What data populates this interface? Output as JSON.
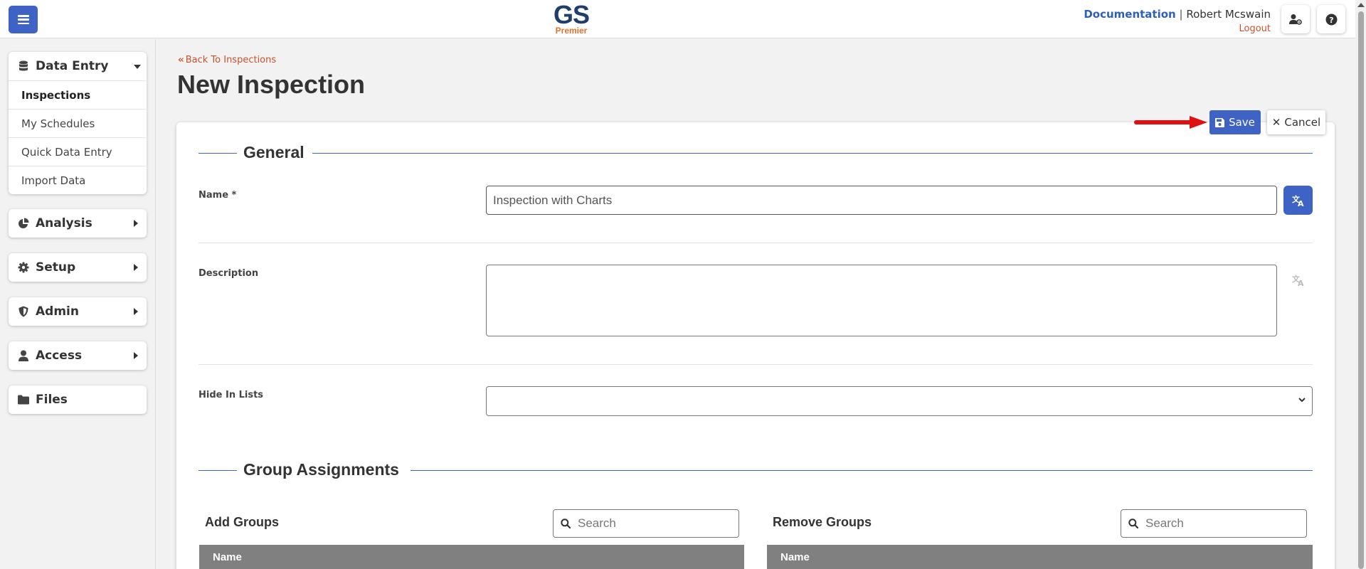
{
  "header": {
    "logo_main": "GS",
    "logo_sub": "Premier",
    "documentation_label": "Documentation",
    "separator": "|",
    "user_name": "Robert Mcswain",
    "logout_label": "Logout"
  },
  "sidebar": {
    "data_entry": {
      "label": "Data Entry",
      "items": [
        {
          "label": "Inspections"
        },
        {
          "label": "My Schedules"
        },
        {
          "label": "Quick Data Entry"
        },
        {
          "label": "Import Data"
        }
      ]
    },
    "analysis_label": "Analysis",
    "setup_label": "Setup",
    "admin_label": "Admin",
    "access_label": "Access",
    "files_label": "Files"
  },
  "main": {
    "back_link": "Back To Inspections",
    "page_title": "New Inspection",
    "save_label": "Save",
    "cancel_label": "Cancel",
    "general_title": "General",
    "name_label": "Name *",
    "name_value": "Inspection with Charts",
    "description_label": "Description",
    "hide_in_lists_label": "Hide In Lists",
    "group_assignments_title": "Group Assignments",
    "add_groups_title": "Add Groups",
    "remove_groups_title": "Remove Groups",
    "search_placeholder": "Search",
    "table_name_header": "Name"
  },
  "colors": {
    "accent": "#3f63c4",
    "link_orange": "#c8522a",
    "logo_navy": "#1f3d6e",
    "annotation_arrow": "#e01010"
  }
}
